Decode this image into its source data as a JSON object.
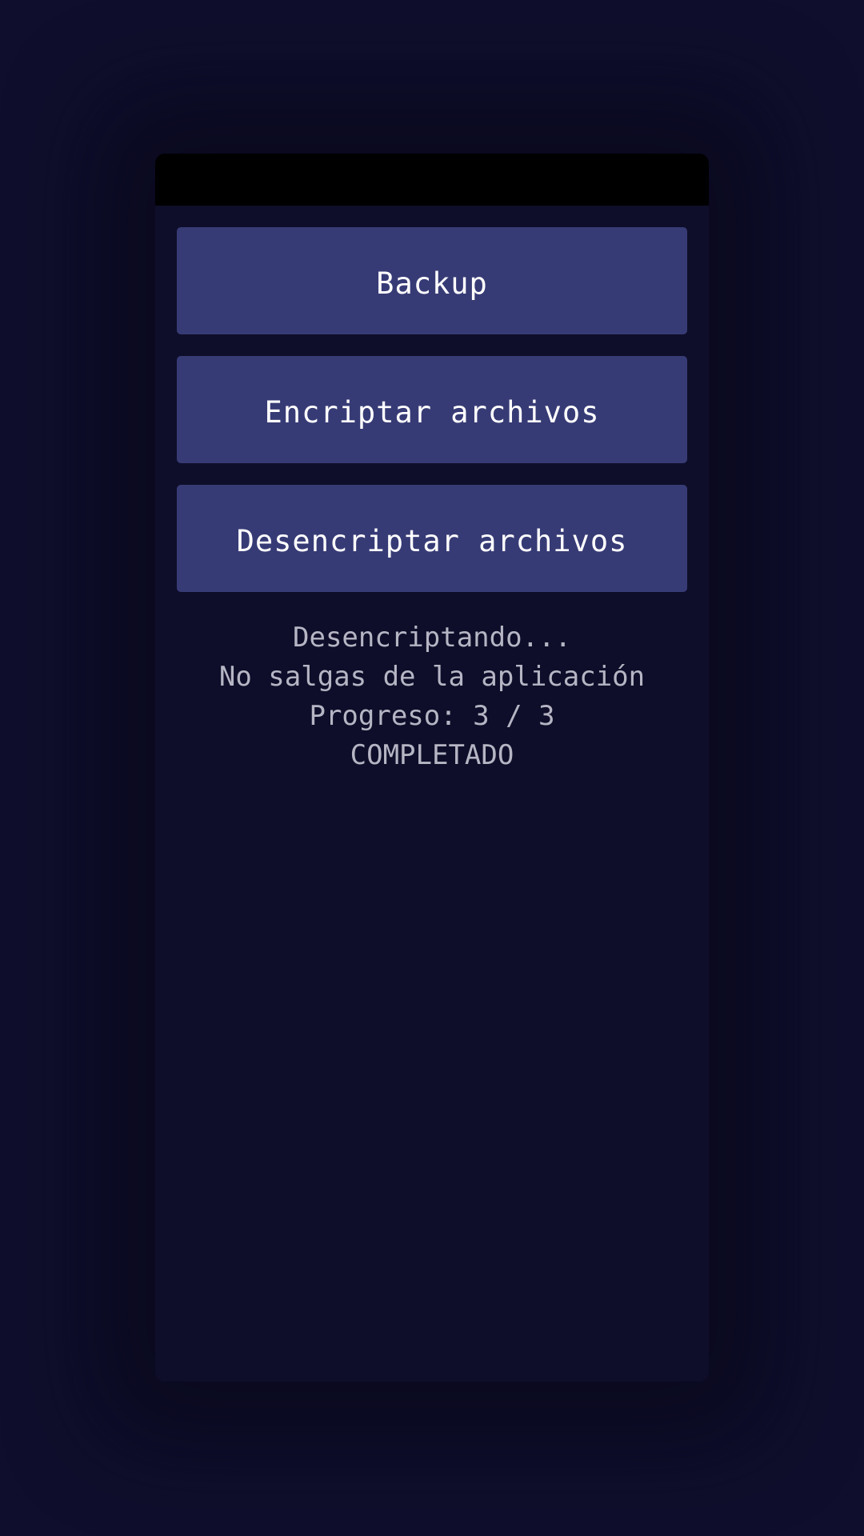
{
  "app": {
    "buttons": {
      "backup_label": "Backup",
      "encrypt_label": "Encriptar archivos",
      "decrypt_label": "Desencriptar archivos"
    },
    "status": {
      "line1": "Desencriptando...",
      "line2": "No salgas de la aplicación",
      "line3": "Progreso: 3 / 3",
      "line4": "COMPLETADO"
    }
  },
  "colors": {
    "background": "#0f0e2c",
    "panel": "#0e0e2a",
    "button": "#373b75",
    "button_text": "#ffffff",
    "status_text": "#b5b5c4",
    "status_bar": "#000000"
  }
}
